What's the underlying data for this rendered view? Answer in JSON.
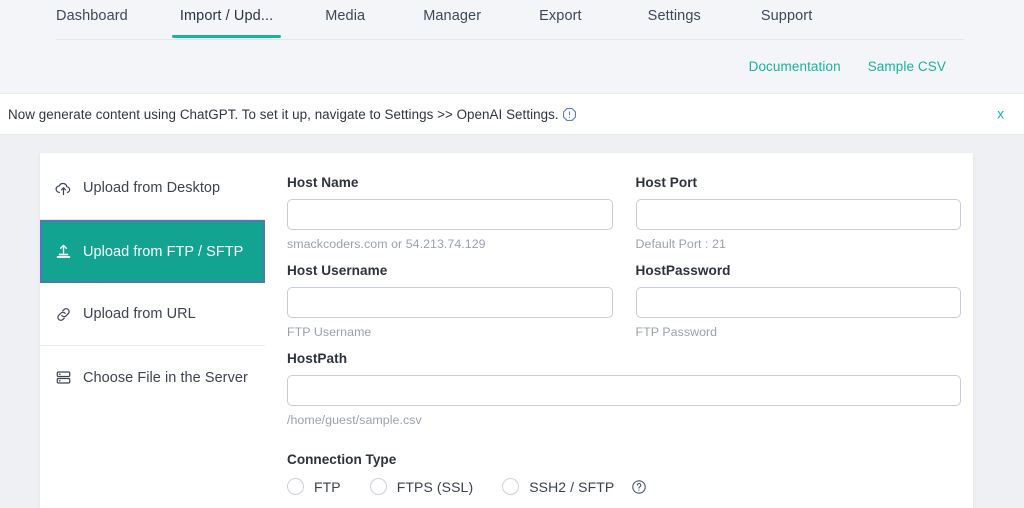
{
  "nav": {
    "tabs": [
      {
        "label": "Dashboard",
        "active": false
      },
      {
        "label": "Import / Upd...",
        "active": true
      },
      {
        "label": "Media",
        "active": false
      },
      {
        "label": "Manager",
        "active": false
      },
      {
        "label": "Export",
        "active": false
      },
      {
        "label": "Settings",
        "active": false
      },
      {
        "label": "Support",
        "active": false
      }
    ],
    "active_underline_color": "#19b39b"
  },
  "doc_links": [
    {
      "label": "Documentation"
    },
    {
      "label": "Sample CSV"
    }
  ],
  "banner": {
    "text": "Now generate content using ChatGPT. To set it up, navigate to Settings >> OpenAI Settings.",
    "icon": "alert-octagon-icon",
    "close_label": "x",
    "close_color": "#17b29a"
  },
  "sidebar": {
    "items": [
      {
        "label": "Upload from Desktop",
        "icon": "cloud-upload-icon",
        "selected": false
      },
      {
        "label": "Upload from FTP / SFTP",
        "icon": "upload-tray-icon",
        "selected": true
      },
      {
        "label": "Upload from URL",
        "icon": "link-icon",
        "selected": false
      },
      {
        "label": "Choose File in the Server",
        "icon": "server-icon",
        "selected": false
      }
    ],
    "selected_bg": "#12a391",
    "focus_outline": "#4e7bb5"
  },
  "form": {
    "fields": [
      {
        "label": "Host Name",
        "value": "",
        "placeholder": "",
        "hint": "smackcoders.com or 54.213.74.129"
      },
      {
        "label": "Host Port",
        "value": "",
        "placeholder": "",
        "hint": "Default Port : 21"
      },
      {
        "label": "Host Username",
        "value": "",
        "placeholder": "",
        "hint": "FTP Username"
      },
      {
        "label": "HostPassword",
        "value": "",
        "placeholder": "",
        "hint": "FTP Password"
      },
      {
        "label": "HostPath",
        "value": "",
        "placeholder": "",
        "hint": "/home/guest/sample.csv"
      }
    ],
    "connection": {
      "title": "Connection Type",
      "options": [
        {
          "label": "FTP",
          "selected": false
        },
        {
          "label": "FTPS (SSL)",
          "selected": false
        },
        {
          "label": "SSH2 / SFTP",
          "selected": false
        }
      ],
      "help_icon": "help-circle-icon"
    }
  }
}
